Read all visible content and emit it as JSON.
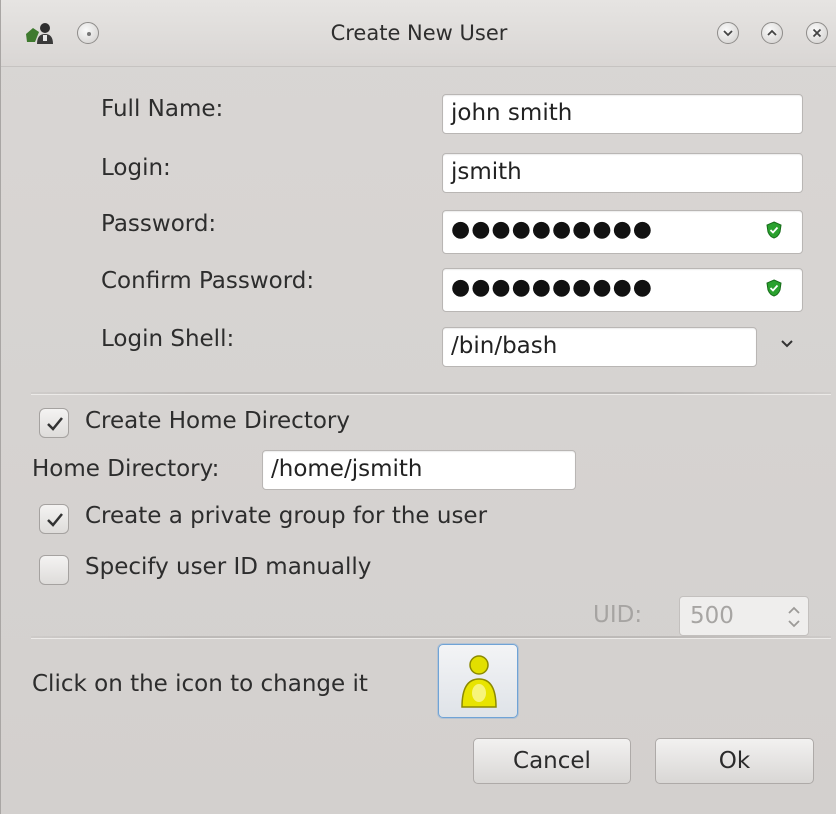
{
  "window": {
    "title": "Create New User"
  },
  "titlebar_icons": {
    "app": "user-admin-icon",
    "menu": "window-menu-icon",
    "minimize": "minimize-icon",
    "maximize": "maximize-icon",
    "close": "close-icon"
  },
  "form": {
    "full_name": {
      "label": "Full Name:",
      "value": "john smith"
    },
    "login": {
      "label": "Login:",
      "value": "jsmith"
    },
    "password": {
      "label": "Password:",
      "value": "●●●●●●●●●●"
    },
    "confirm_password": {
      "label": "Confirm Password:",
      "value": "●●●●●●●●●●"
    },
    "login_shell": {
      "label": "Login Shell:",
      "value": "/bin/bash"
    }
  },
  "options": {
    "create_home": {
      "label": "Create Home Directory",
      "checked": true
    },
    "home_dir": {
      "label": "Home Directory:",
      "value": "/home/jsmith"
    },
    "private_group": {
      "label": "Create a private group for the user",
      "checked": true
    },
    "specify_uid": {
      "label": "Specify user ID manually",
      "checked": false
    },
    "uid": {
      "label": "UID:",
      "value": "500"
    }
  },
  "icon_section": {
    "label": "Click on the icon to change it"
  },
  "buttons": {
    "cancel": "Cancel",
    "ok": "Ok"
  },
  "colors": {
    "accent": "#6fa3d6",
    "shield_green": "#2aa12e",
    "avatar_yellow": "#e6e000"
  }
}
